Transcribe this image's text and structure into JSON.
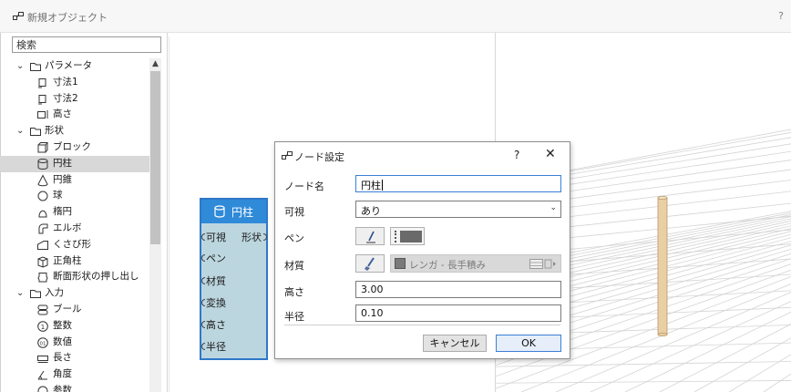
{
  "window": {
    "title": "新規オブジェクト",
    "help": "?"
  },
  "search": {
    "placeholder": "検索"
  },
  "tree": [
    {
      "label": "パラメータ",
      "level": 0,
      "expandable": true,
      "icon": "folder-icon"
    },
    {
      "label": "寸法1",
      "level": 1,
      "icon": "dimension-icon"
    },
    {
      "label": "寸法2",
      "level": 1,
      "icon": "dimension-icon"
    },
    {
      "label": "高さ",
      "level": 1,
      "icon": "height-icon"
    },
    {
      "label": "形状",
      "level": 0,
      "expandable": true,
      "icon": "folder-icon"
    },
    {
      "label": "ブロック",
      "level": 1,
      "icon": "block-icon"
    },
    {
      "label": "円柱",
      "level": 1,
      "icon": "cylinder-icon",
      "selected": true
    },
    {
      "label": "円錐",
      "level": 1,
      "icon": "cone-icon"
    },
    {
      "label": "球",
      "level": 1,
      "icon": "sphere-icon"
    },
    {
      "label": "楕円",
      "level": 1,
      "icon": "ellipsoid-icon"
    },
    {
      "label": "エルボ",
      "level": 1,
      "icon": "elbow-icon"
    },
    {
      "label": "くさび形",
      "level": 1,
      "icon": "wedge-icon"
    },
    {
      "label": "正角柱",
      "level": 1,
      "icon": "prism-icon"
    },
    {
      "label": "断面形状の押し出し",
      "level": 1,
      "icon": "extrude-icon"
    },
    {
      "label": "入力",
      "level": 0,
      "expandable": true,
      "icon": "folder-icon"
    },
    {
      "label": "ブール",
      "level": 1,
      "icon": "boolean-icon"
    },
    {
      "label": "整数",
      "level": 1,
      "icon": "integer-icon"
    },
    {
      "label": "数値",
      "level": 1,
      "icon": "number-icon"
    },
    {
      "label": "長さ",
      "level": 1,
      "icon": "length-icon"
    },
    {
      "label": "角度",
      "level": 1,
      "icon": "angle-icon"
    },
    {
      "label": "参数",
      "level": 1,
      "icon": "parameter-icon"
    }
  ],
  "node": {
    "title": "円柱",
    "icon": "cylinder-icon",
    "inputs": [
      "可視",
      "ペン",
      "材質",
      "変換",
      "高さ",
      "半径"
    ],
    "output": "形状"
  },
  "dialog": {
    "title": "ノード設定",
    "help": "?",
    "close": "✕",
    "labels": {
      "name": "ノード名",
      "visible": "可視",
      "pen": "ペン",
      "material": "材質",
      "height": "高さ",
      "radius": "半径"
    },
    "values": {
      "name": "円柱",
      "visible": "あり",
      "material": "レンガ - 長手積み",
      "height": "3.00",
      "radius": "0.10"
    },
    "buttons": {
      "cancel": "キャンセル",
      "ok": "OK"
    }
  },
  "colors": {
    "node_header": "#2f8ad8",
    "node_body": "#bcd6df",
    "accent": "#3b7fd6",
    "cylinder": "#e8cfa4"
  }
}
